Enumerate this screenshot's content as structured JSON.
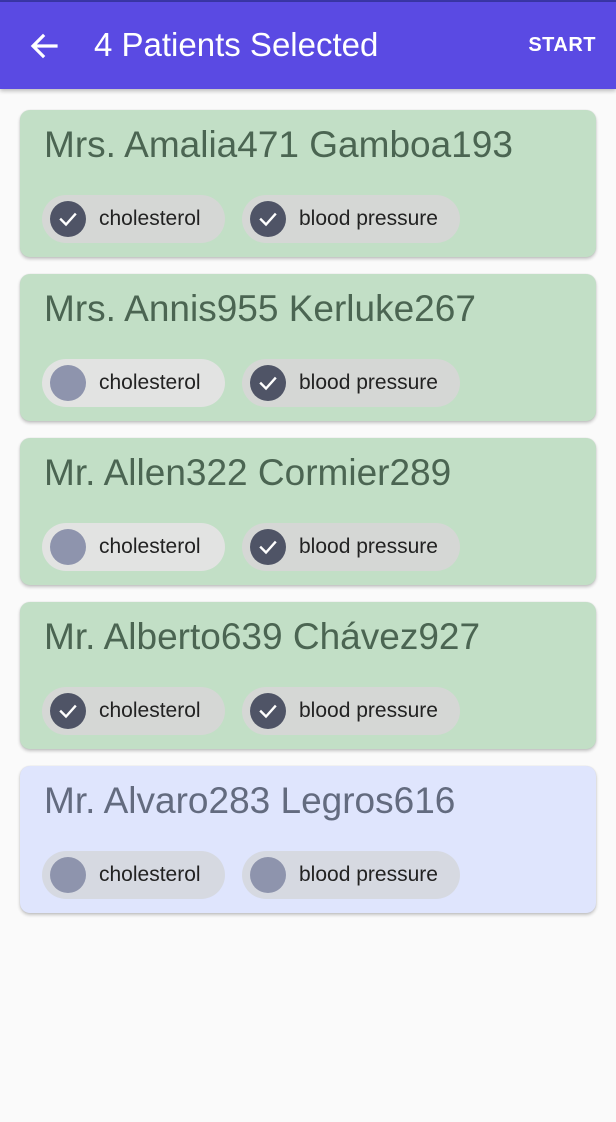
{
  "app_bar": {
    "title": "4 Patients Selected",
    "action_label": "START",
    "color": "#5a4ae3"
  },
  "patients": [
    {
      "name": "Mrs. Amalia471 Gamboa193",
      "selected": true,
      "tests": [
        {
          "label": "cholesterol",
          "checked": true
        },
        {
          "label": "blood pressure",
          "checked": true
        }
      ]
    },
    {
      "name": "Mrs. Annis955 Kerluke267",
      "selected": true,
      "tests": [
        {
          "label": "cholesterol",
          "checked": false
        },
        {
          "label": "blood pressure",
          "checked": true
        }
      ]
    },
    {
      "name": "Mr. Allen322 Cormier289",
      "selected": true,
      "tests": [
        {
          "label": "cholesterol",
          "checked": false
        },
        {
          "label": "blood pressure",
          "checked": true
        }
      ]
    },
    {
      "name": "Mr. Alberto639 Chávez927",
      "selected": true,
      "tests": [
        {
          "label": "cholesterol",
          "checked": true
        },
        {
          "label": "blood pressure",
          "checked": true
        }
      ]
    },
    {
      "name": "Mr. Alvaro283 Legros616",
      "selected": false,
      "tests": [
        {
          "label": "cholesterol",
          "checked": false
        },
        {
          "label": "blood pressure",
          "checked": false
        }
      ]
    }
  ],
  "colors": {
    "selected_card": "#c2dfc6",
    "unselected_card": "#dfe5fd",
    "checked_dot": "#4f5466",
    "unchecked_dot": "#8e94ad"
  }
}
